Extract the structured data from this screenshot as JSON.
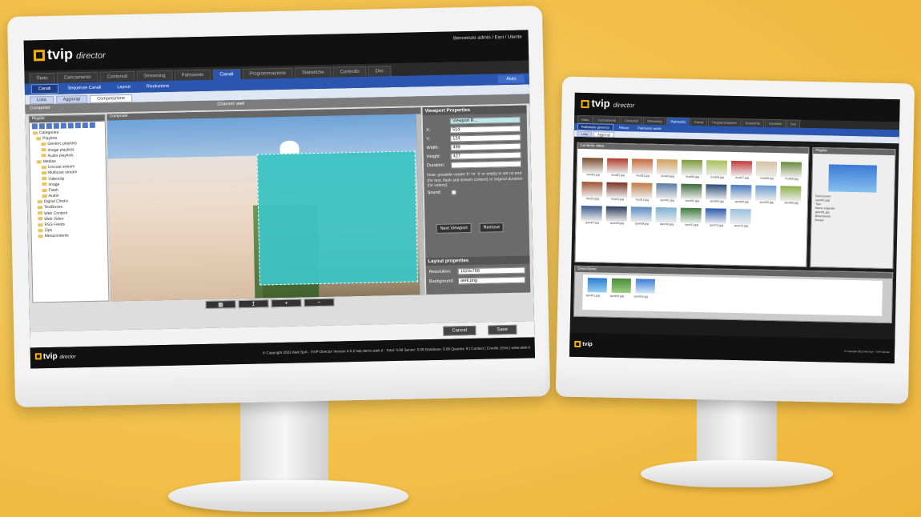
{
  "monitor1": {
    "logo": {
      "brand": "tvip",
      "sub": "director"
    },
    "welcome": "Benvenuto admin / Esci / Utente",
    "tabs": [
      "Stato",
      "Caricamento",
      "Contenuti",
      "Streaming",
      "Palinsesto",
      "Canali",
      "Programmazione",
      "Statistiche",
      "Controllo",
      "Doc"
    ],
    "active_tab": "Canali",
    "subtabs": [
      "Canali",
      "Sequenze Canali",
      "Layout",
      "Risoluzione"
    ],
    "aiuto": "Aiuto",
    "subsubtabs": [
      "Lista",
      "Aggiungi",
      "Composizione"
    ],
    "composer_label": "Composer",
    "channel_title": "Channel: atek",
    "playlist": {
      "title": "Playlist",
      "tree": [
        "Categories",
        "Playlists",
        "Generic playlists",
        "Image playlists",
        "Audio playlists",
        "Medias",
        "Unicast stream",
        "Multicast stream",
        "Videoclip",
        "Image",
        "Flash",
        "Audio",
        "Digital Clocks",
        "TextBoxes",
        "Web Content",
        "Web Video",
        "RSS Feeds",
        "Zips",
        "Metacontents"
      ]
    },
    "composer_title": "Composer",
    "viewport": {
      "title": "Viewport Properties",
      "name_value": "Viewport R...",
      "x_label": "X:",
      "x_value": "514",
      "y_label": "Y:",
      "y_value": "124",
      "w_label": "Width:",
      "w_value": "499",
      "h_label": "Height:",
      "h_value": "427",
      "d_label": "Duration:",
      "d_value": "",
      "note": "Note: possible values 'h' 'm' 's' or empty to set no end (for text, flash and stream content) or original duration (for videos)",
      "sound_label": "Sound:",
      "next_btn": "Next Viewport",
      "remove_btn": "Remove"
    },
    "layout": {
      "title": "Layout properties",
      "res_label": "Resolution:",
      "res_value": "1024x768",
      "bg_label": "Background:",
      "bg_value": "atek.png"
    },
    "toolbar": [
      "▦",
      "↥",
      "+",
      "−"
    ],
    "cancel": "Cancel",
    "save": "Save",
    "footer_logo": "tvip",
    "footer_sub": "director",
    "copyright": "© Copyright 2022 Atek SpA - TVIP Director Version 4.0.2 tvip-demo.atek.it - Total: 0.66 Server: 0.06 Database: 0.00 Queries: 8 | Contact | Credits | Esis | www.atek.it"
  },
  "monitor2": {
    "logo": {
      "brand": "tvip",
      "sub": "director"
    },
    "tabs": [
      "Stato",
      "Caricamento",
      "Contenuti",
      "Streaming",
      "Palinsesto",
      "Canali",
      "Programmazione",
      "Statistiche",
      "Controllo",
      "Doc"
    ],
    "active_tab": "Palinsesto",
    "subtabs": [
      "Palinsesto generico",
      "Filtrare",
      "Palinsesto audio"
    ],
    "subsubtabs": [
      "Lista",
      "Aggiungi"
    ],
    "contents_title": "Contents video",
    "thumb_captions": [
      "food01.jpg",
      "food02.jpg",
      "food03.jpg",
      "food04.jpg",
      "food05.jpg",
      "food06.jpg",
      "food07.jpg",
      "food08.jpg",
      "food09.jpg",
      "food10.jpg",
      "food11.jpg",
      "food12.jpg",
      "sport01.jpg",
      "sport02.jpg",
      "sport03.jpg",
      "sport04.jpg",
      "sport05.jpg",
      "sport06.jpg",
      "sport07.jpg",
      "sport08.jpg",
      "sport09.jpg",
      "sport10.jpg",
      "sport11.jpg",
      "sport12.jpg",
      "sport13.jpg"
    ],
    "playlist_title": "Playlist",
    "info_lines": [
      "Descrizione:",
      "sport01.jpg",
      "Tipo:",
      "Nome originale:",
      "sport01.jpg",
      "Dimensione:",
      "Durata:"
    ],
    "descriptors_title": "Descrizione",
    "ds_captions": [
      "sport01.jpg",
      "sport02.jpg",
      "sport03.jpg"
    ],
    "copyright": "© Copyright 2022 Atek SpA - TVIP Director"
  },
  "colors": {
    "accent": "#2b56b0",
    "brand": "#f5b000",
    "background": "#f2c04a",
    "viewport": "#3ec4c4"
  }
}
